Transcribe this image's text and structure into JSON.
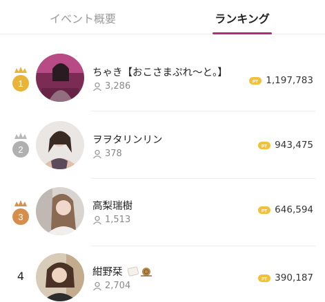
{
  "tabs": {
    "event_overview": "イベント概要",
    "ranking": "ランキング"
  },
  "colors": {
    "accent": "#b4287e",
    "gold": "#e8b53a",
    "silver": "#b8b8b8",
    "bronze": "#d9904a",
    "pt_badge": "#f2c13a"
  },
  "ranking": [
    {
      "rank": "1",
      "medal": "gold",
      "name": "ちゃき【おこさまぷれ〜と。】",
      "followers": "3,286",
      "points": "1,197,783",
      "pt_label": "PT"
    },
    {
      "rank": "2",
      "medal": "silver",
      "name": "ヲヲタリンリン",
      "followers": "378",
      "points": "943,475",
      "pt_label": "PT"
    },
    {
      "rank": "3",
      "medal": "bronze",
      "name": "高梨瑞樹",
      "followers": "1,513",
      "points": "646,594",
      "pt_label": "PT"
    },
    {
      "rank": "4",
      "medal": "none",
      "name": "紺野栞",
      "followers": "2,704",
      "points": "390,187",
      "pt_label": "PT"
    }
  ]
}
